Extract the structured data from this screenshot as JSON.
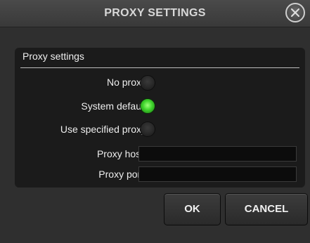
{
  "dialog": {
    "title": "PROXY SETTINGS"
  },
  "group": {
    "title": "Proxy settings"
  },
  "options": [
    {
      "label": "No proxy",
      "selected": false
    },
    {
      "label": "System default",
      "selected": true
    },
    {
      "label": "Use specified proxy",
      "selected": false
    }
  ],
  "fields": {
    "host": {
      "label": "Proxy host:",
      "value": ""
    },
    "port": {
      "label": "Proxy port:",
      "value": ""
    }
  },
  "buttons": {
    "ok": "OK",
    "cancel": "CANCEL"
  },
  "colors": {
    "selected_radio": "#3ed32b",
    "background": "#2f2f2f",
    "panel": "#1b1b1b"
  }
}
